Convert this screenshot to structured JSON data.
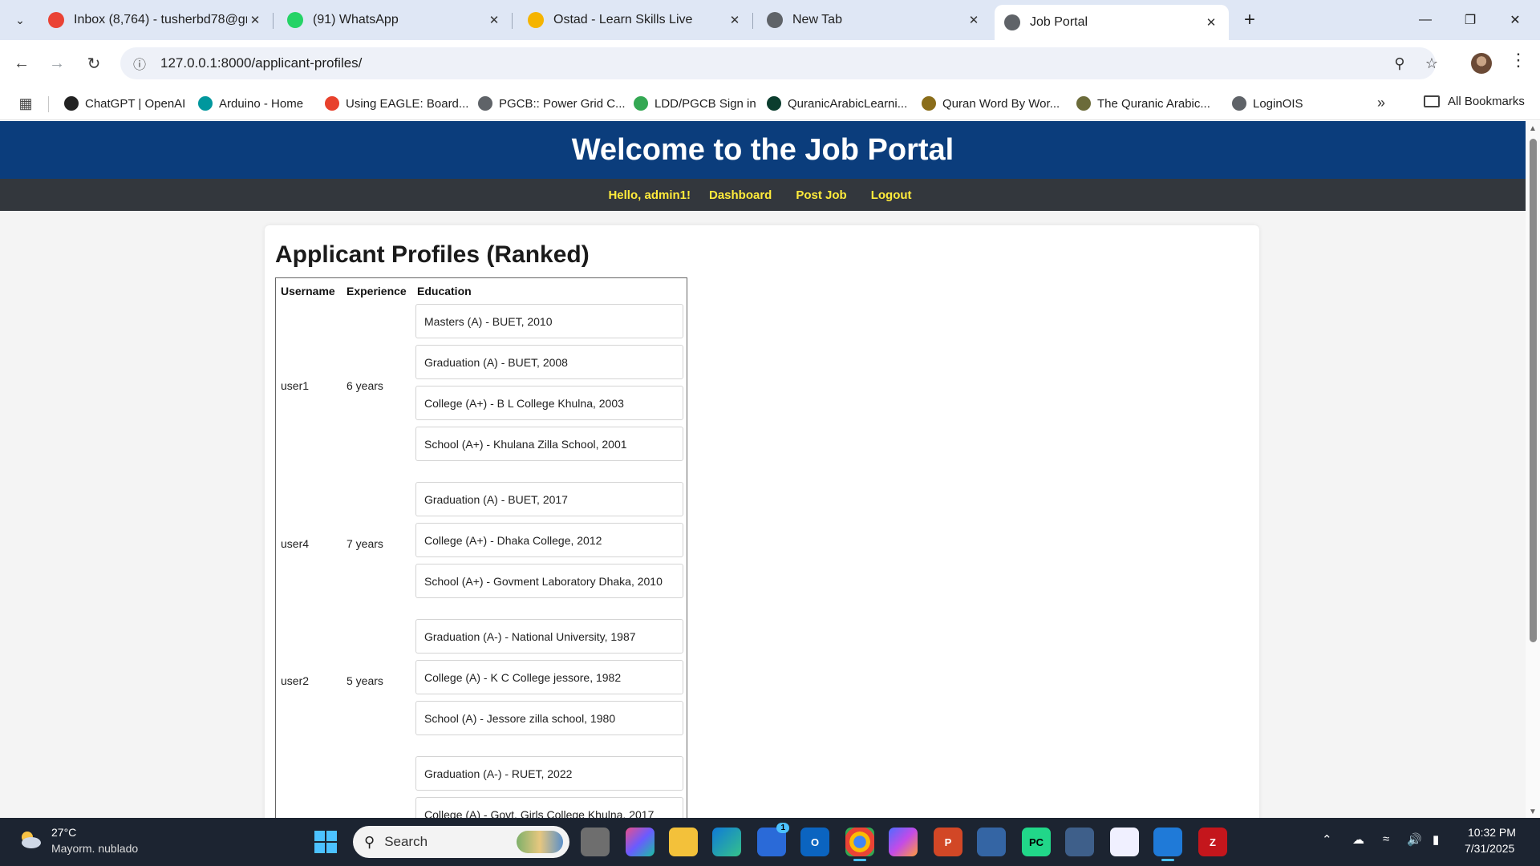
{
  "browser": {
    "tabs": [
      {
        "title": "Inbox (8,764) - tusherbd78@gm",
        "icon": "gmail-icon",
        "color": "#ea4335"
      },
      {
        "title": "(91) WhatsApp",
        "icon": "whatsapp-icon",
        "color": "#25d366"
      },
      {
        "title": "Ostad - Learn Skills Live",
        "icon": "ostad-icon",
        "color": "#f5b400"
      },
      {
        "title": "New Tab",
        "icon": "chrome-icon",
        "color": "#5f6368"
      },
      {
        "title": "Job Portal",
        "icon": "globe-icon",
        "color": "#5f6368"
      }
    ],
    "url": "127.0.0.1:8000/applicant-profiles/",
    "bookmarks": [
      {
        "label": "ChatGPT | OpenAI",
        "icon": "openai-icon",
        "color": "#222222"
      },
      {
        "label": "Arduino - Home",
        "icon": "arduino-icon",
        "color": "#00979d"
      },
      {
        "label": "Using EAGLE: Board...",
        "icon": "eagle-icon",
        "color": "#e8412c"
      },
      {
        "label": "PGCB:: Power Grid C...",
        "icon": "globe-icon",
        "color": "#5f6368"
      },
      {
        "label": "LDD/PGCB Sign in",
        "icon": "play-icon",
        "color": "#34a853"
      },
      {
        "label": "QuranicArabicLearni...",
        "icon": "quran-icon",
        "color": "#0b3d2e"
      },
      {
        "label": "Quran Word By Wor...",
        "icon": "q-icon",
        "color": "#8a6d1a"
      },
      {
        "label": "The Quranic Arabic...",
        "icon": "book-icon",
        "color": "#6b6b3a"
      },
      {
        "label": "LoginOIS",
        "icon": "globe-icon",
        "color": "#5f6368"
      }
    ],
    "all_bookmarks": "All Bookmarks"
  },
  "site": {
    "header_title": "Welcome to the Job Portal",
    "nav": {
      "greeting": "Hello, admin1!",
      "links": [
        "Dashboard",
        "Post Job",
        "Logout"
      ]
    },
    "accent": "#0b3d7c",
    "nav_color": "#ffeb3b"
  },
  "profiles": {
    "heading": "Applicant Profiles (Ranked)",
    "columns": [
      "Username",
      "Experience",
      "Education"
    ],
    "rows": [
      {
        "username": "user1",
        "experience": "6 years",
        "education": [
          "Masters (A) - BUET, 2010",
          "Graduation (A) - BUET, 2008",
          "College (A+) - B L College Khulna, 2003",
          "School (A+) - Khulana Zilla School, 2001"
        ]
      },
      {
        "username": "user4",
        "experience": "7 years",
        "education": [
          "Graduation (A) - BUET, 2017",
          "College (A+) - Dhaka College, 2012",
          "School (A+) - Govment Laboratory Dhaka, 2010"
        ]
      },
      {
        "username": "user2",
        "experience": "5 years",
        "education": [
          "Graduation (A-) - National University, 1987",
          "College (A) - K C College jessore, 1982",
          "School (A) - Jessore zilla school, 1980"
        ]
      },
      {
        "username": "",
        "experience": "",
        "education": [
          "Graduation (A-) - RUET, 2022",
          "College (A) - Govt. Girls College Khulna, 2017"
        ]
      }
    ]
  },
  "taskbar": {
    "temperature": "27°C",
    "weather": "Mayorm. nublado",
    "search_label": "Search",
    "time": "10:32 PM",
    "date": "7/31/2025",
    "store_badge": "1"
  }
}
